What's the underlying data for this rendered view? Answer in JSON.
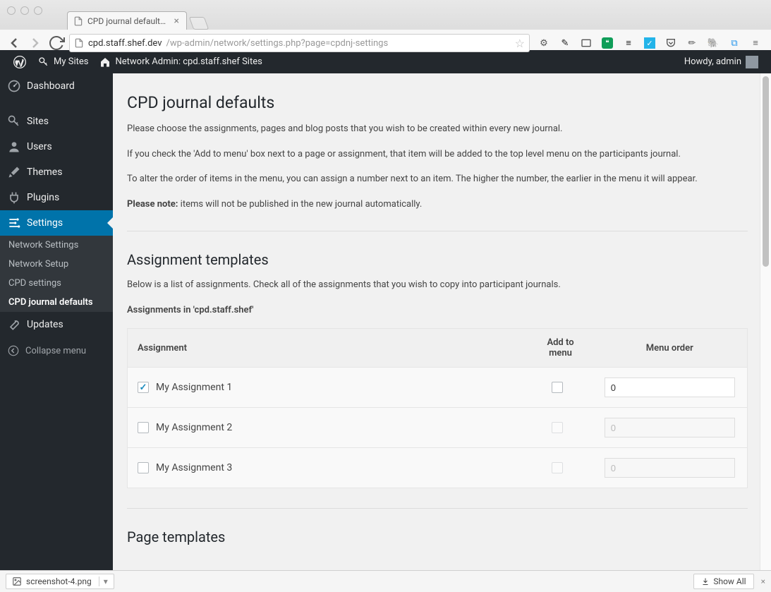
{
  "browser": {
    "tab_title": "CPD journal defaults ‹ Netw",
    "url_host": "cpd.staff.shef.dev",
    "url_path": "/wp-admin/network/settings.php?page=cpdnj-settings"
  },
  "adminbar": {
    "my_sites": "My Sites",
    "network_admin": "Network Admin: cpd.staff.shef Sites",
    "howdy": "Howdy, admin"
  },
  "sidebar": {
    "dashboard": "Dashboard",
    "sites": "Sites",
    "users": "Users",
    "themes": "Themes",
    "plugins": "Plugins",
    "settings": "Settings",
    "submenu": {
      "network_settings": "Network Settings",
      "network_setup": "Network Setup",
      "cpd_settings": "CPD settings",
      "cpd_journal_defaults": "CPD journal defaults"
    },
    "updates": "Updates",
    "collapse": "Collapse menu"
  },
  "page": {
    "title": "CPD journal defaults",
    "intro1": "Please choose the assignments, pages and blog posts that you wish to be created within every new journal.",
    "intro2": "If you check the 'Add to menu' box next to a page or assignment, that item will be added to the top level menu on the participants journal.",
    "intro3": "To alter the order of items in the menu, you can assign a number next to an item. The higher the number, the earlier in the menu it will appear.",
    "note_label": "Please note:",
    "note_text": " items will not be published in the new journal automatically.",
    "section1_title": "Assignment templates",
    "section1_desc": "Below is a list of assignments. Check all of the assignments that you wish to copy into participant journals.",
    "section1_sub": "Assignments in 'cpd.staff.shef'",
    "tbl": {
      "col_assignment": "Assignment",
      "col_add": "Add to menu",
      "col_order": "Menu order"
    },
    "rows": [
      {
        "label": "My Assignment 1",
        "checked": true,
        "add_enabled": true,
        "order": "0",
        "order_enabled": true
      },
      {
        "label": "My Assignment 2",
        "checked": false,
        "add_enabled": false,
        "order": "0",
        "order_enabled": false
      },
      {
        "label": "My Assignment 3",
        "checked": false,
        "add_enabled": false,
        "order": "0",
        "order_enabled": false
      }
    ],
    "section2_title": "Page templates"
  },
  "download": {
    "file": "screenshot-4.png",
    "show_all": "Show All"
  }
}
